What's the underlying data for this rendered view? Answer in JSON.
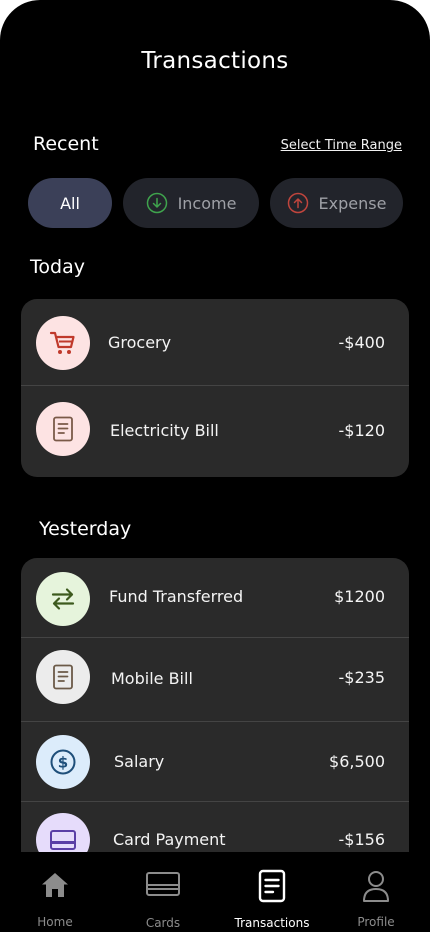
{
  "header": {
    "title": "Transactions"
  },
  "filters": {
    "recent_label": "Recent",
    "time_range_link": "Select Time Range",
    "chips": [
      {
        "label": "All",
        "icon": "none",
        "selected": true
      },
      {
        "label": "Income",
        "icon": "arrow-down-circle-icon",
        "selected": false
      },
      {
        "label": "Expense",
        "icon": "arrow-up-circle-icon",
        "selected": false
      }
    ]
  },
  "today": {
    "label": "Today",
    "items": [
      {
        "name": "Grocery",
        "amount": "-$400",
        "icon": "cart-icon",
        "icon_bg": "#fde3e3",
        "icon_color": "#c0392b"
      },
      {
        "name": "Electricity Bill",
        "amount": "-$120",
        "icon": "bill-icon",
        "icon_bg": "#fde3e3",
        "icon_color": "#7a5a48"
      }
    ]
  },
  "yesterday": {
    "label": "Yesterday",
    "items": [
      {
        "name": "Fund Transferred",
        "amount": "$1200",
        "icon": "transfer-icon",
        "icon_bg": "#e6f4dc",
        "icon_color": "#3d5a1e"
      },
      {
        "name": "Mobile Bill",
        "amount": "-$235",
        "icon": "bill-icon",
        "icon_bg": "#ececec",
        "icon_color": "#6b5a48"
      },
      {
        "name": "Salary",
        "amount": "$6,500",
        "icon": "dollar-icon",
        "icon_bg": "#dcecfb",
        "icon_color": "#1f4f7a"
      },
      {
        "name": "Card Payment",
        "amount": "-$156",
        "icon": "card-icon",
        "icon_bg": "#e6dcfb",
        "icon_color": "#5b3fa6"
      }
    ]
  },
  "bottom_nav": {
    "items": [
      {
        "label": "Home",
        "icon": "home-icon",
        "active": false
      },
      {
        "label": "Cards",
        "icon": "cards-icon",
        "active": false
      },
      {
        "label": "Transactions",
        "icon": "transactions-icon",
        "active": true
      },
      {
        "label": "Profile",
        "icon": "profile-icon",
        "active": false
      }
    ]
  },
  "colors": {
    "background": "#000000",
    "card": "#2a2a2a",
    "chip_selected": "#3b4058",
    "chip_unselected": "#22242b",
    "income_green": "#3fa34d",
    "expense_red": "#c0453d"
  }
}
